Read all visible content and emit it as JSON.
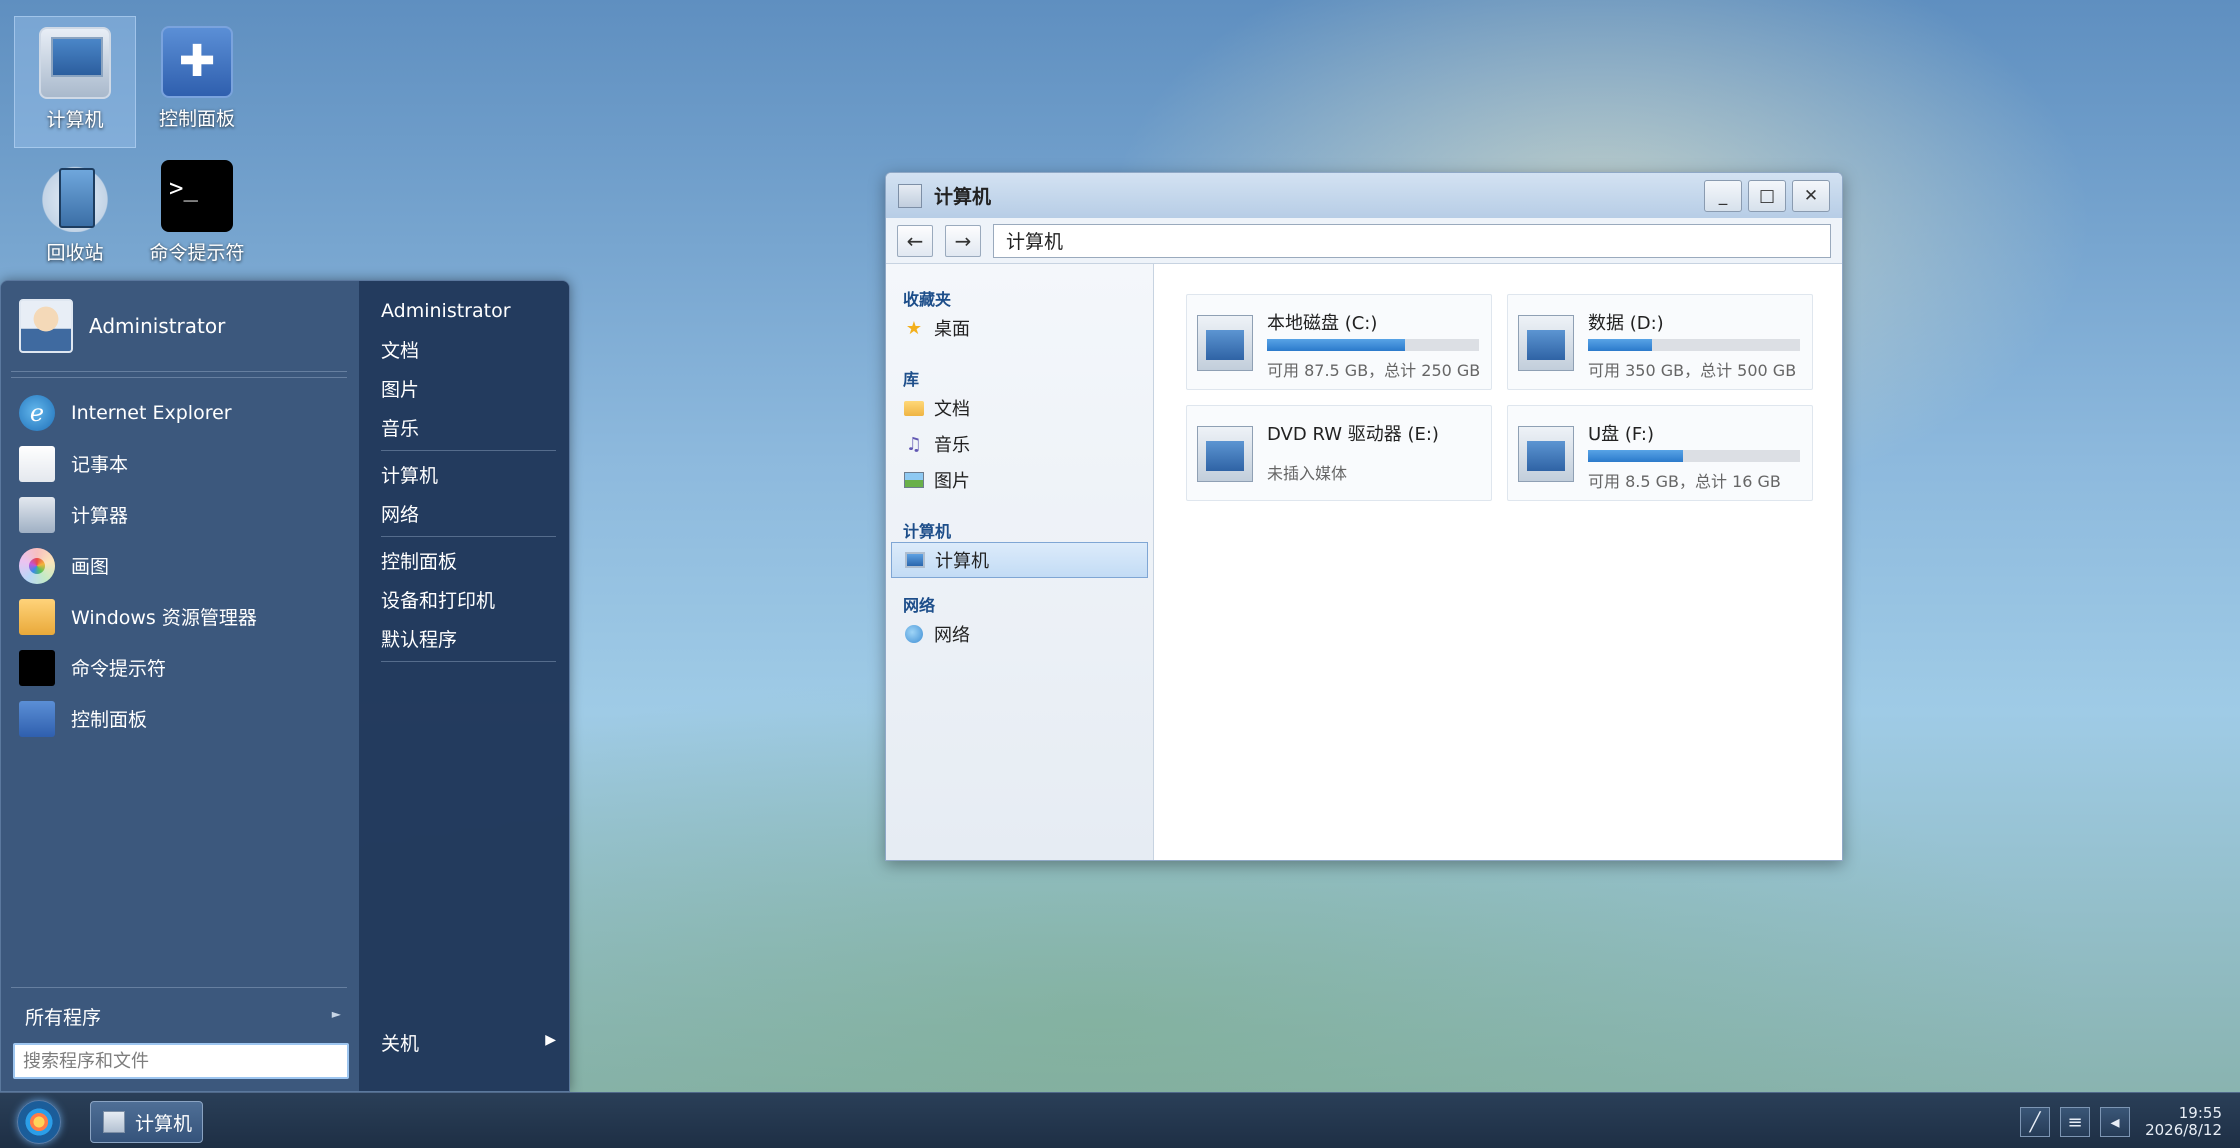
{
  "desktop": {
    "icons": [
      {
        "label": "计算机"
      },
      {
        "label": "控制面板"
      },
      {
        "label": "回收站"
      },
      {
        "label": "命令提示符",
        "glyph": ">_"
      }
    ]
  },
  "start_menu": {
    "user_name": "Administrator",
    "apps": [
      {
        "label": "Internet Explorer",
        "icon": "ie-icon"
      },
      {
        "label": "记事本",
        "icon": "notepad-icon"
      },
      {
        "label": "计算器",
        "icon": "calculator-icon"
      },
      {
        "label": "画图",
        "icon": "paint-icon"
      },
      {
        "label": "Windows 资源管理器",
        "icon": "explorer-icon"
      },
      {
        "label": "命令提示符",
        "icon": "cmd-icon"
      },
      {
        "label": "控制面板",
        "icon": "control-panel-icon"
      }
    ],
    "all_programs": "所有程序",
    "search_placeholder": "搜索程序和文件",
    "right_items": [
      "Administrator",
      "文档",
      "图片",
      "音乐",
      "计算机",
      "网络",
      "控制面板",
      "设备和打印机",
      "默认程序"
    ],
    "shutdown": "关机"
  },
  "explorer": {
    "title": "计算机",
    "address": "计算机",
    "nav": {
      "favorites": {
        "header": "收藏夹",
        "items": [
          "桌面"
        ]
      },
      "libraries": {
        "header": "库",
        "items": [
          "文档",
          "音乐",
          "图片"
        ]
      },
      "computer": {
        "header": "计算机",
        "items": [
          "计算机"
        ]
      },
      "network": {
        "header": "网络",
        "items": [
          "网络"
        ]
      }
    },
    "drives": [
      {
        "name": "本地磁盘 (C:)",
        "info": "可用 87.5 GB，总计 250 GB",
        "used_fraction": 0.65
      },
      {
        "name": "数据 (D:)",
        "info": "可用 350 GB，总计 500 GB",
        "used_fraction": 0.3
      },
      {
        "name": "DVD RW 驱动器 (E:)",
        "info": "未插入媒体"
      },
      {
        "name": "U盘 (F:)",
        "info": "可用 8.5 GB，总计 16 GB",
        "used_fraction": 0.45
      }
    ],
    "window_buttons": {
      "minimize": "_",
      "maximize": "□",
      "close": "✕"
    },
    "nav_back": "←",
    "nav_forward": "→"
  },
  "taskbar": {
    "task_label": "计算机",
    "clock_time": "19:55",
    "clock_date": "2026/8/12"
  },
  "colors": {
    "accent": "#2b7acb",
    "start_menu_bg": "#283f5e",
    "taskbar_bg": "#1e2f45"
  }
}
